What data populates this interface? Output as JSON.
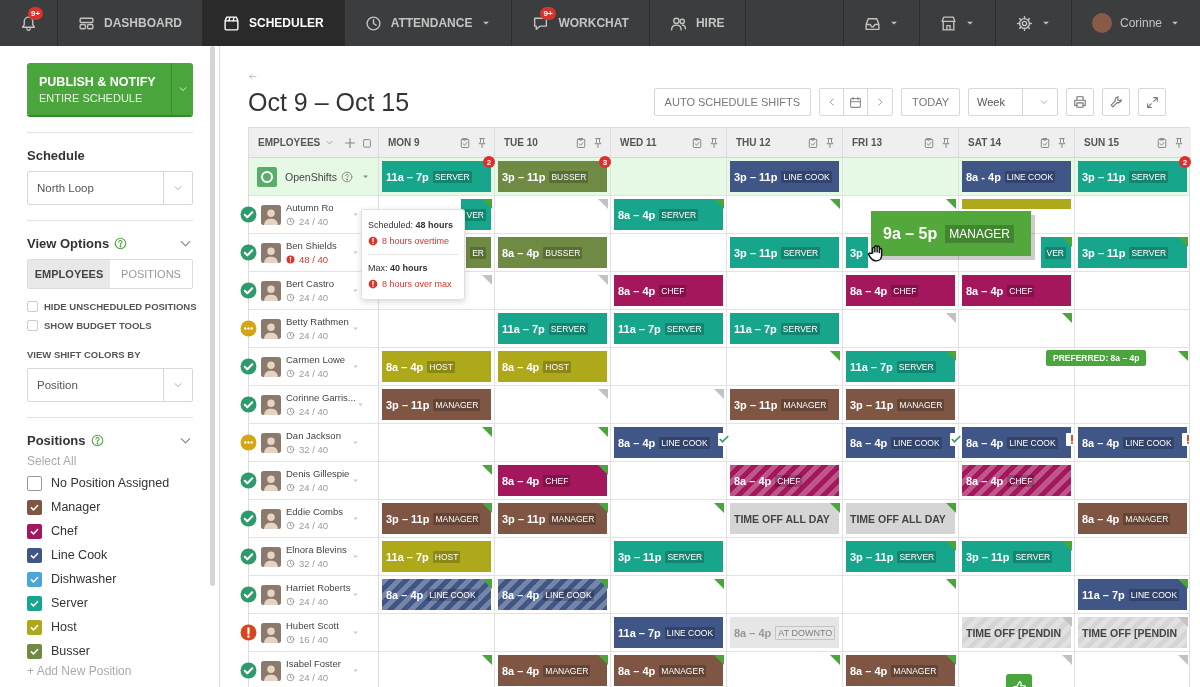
{
  "nav": {
    "items": [
      {
        "badge": "9+",
        "selected": false,
        "dropdown": false
      },
      {
        "label": "DASHBOARD",
        "selected": false,
        "dropdown": false
      },
      {
        "label": "SCHEDULER",
        "selected": true,
        "dropdown": false
      },
      {
        "label": "ATTENDANCE",
        "selected": false,
        "dropdown": true
      },
      {
        "label": "WORKCHAT",
        "badge": "9+",
        "selected": false,
        "dropdown": false
      },
      {
        "label": "HIRE",
        "selected": false,
        "dropdown": false
      }
    ],
    "right": [
      {
        "dropdown": true
      },
      {
        "dropdown": true
      },
      {
        "dropdown": true
      }
    ],
    "user": {
      "name": "Corinne",
      "dropdown": true
    }
  },
  "sidebar": {
    "publish": {
      "title": "PUBLISH & NOTIFY",
      "subtitle": "ENTIRE SCHEDULE"
    },
    "schedule": {
      "label": "Schedule",
      "value": "North Loop"
    },
    "view_options": {
      "title": "View Options",
      "expanded": true,
      "tabs": [
        {
          "label": "EMPLOYEES",
          "selected": true
        },
        {
          "label": "POSITIONS",
          "selected": false
        }
      ],
      "checkboxes": [
        {
          "label": "HIDE UNSCHEDULED POSITIONS",
          "checked": false
        },
        {
          "label": "SHOW BUDGET TOOLS",
          "checked": false
        }
      ],
      "color_by": {
        "label": "VIEW SHIFT COLORS BY",
        "value": "Position"
      }
    },
    "positions": {
      "title": "Positions",
      "expanded": true,
      "select_all": "Select All",
      "items": [
        {
          "label": "No Position Assigned",
          "checked": false
        },
        {
          "label": "Manager",
          "checked": true,
          "color": "#7e5643"
        },
        {
          "label": "Chef",
          "checked": true,
          "color": "#a4175d"
        },
        {
          "label": "Line Cook",
          "checked": true,
          "color": "#3f5687"
        },
        {
          "label": "Dishwasher",
          "checked": true,
          "color": "#4aa6d6"
        },
        {
          "label": "Server",
          "checked": true,
          "color": "#17a58c"
        },
        {
          "label": "Host",
          "checked": true,
          "color": "#aea91a"
        },
        {
          "label": "Busser",
          "checked": true,
          "color": "#6e8a43"
        }
      ],
      "add": "+ Add New Position"
    }
  },
  "header": {
    "title": "Oct 9 – Oct 15",
    "auto_button": "AUTO SCHEDULE SHIFTS",
    "today_button": "TODAY",
    "range": "Week"
  },
  "grid": {
    "employees_label": "EMPLOYEES",
    "days": [
      "MON 9",
      "TUE 10",
      "WED 11",
      "THU 12",
      "FRI 13",
      "SAT 14",
      "SUN 15"
    ],
    "open_shifts": {
      "label": "OpenShifts",
      "cells": [
        {
          "kind": "shift",
          "time": "11a – 7p",
          "role": "SERVER",
          "color": "#17a58c",
          "striped": false,
          "badge": "2"
        },
        {
          "kind": "shift",
          "time": "3p – 11p",
          "role": "BUSSER",
          "color": "#6e8a43",
          "striped": false,
          "badge": "3"
        },
        {
          "kind": "empty"
        },
        {
          "kind": "shift",
          "time": "3p – 11p",
          "role": "LINE COOK",
          "color": "#3f5687",
          "striped": false
        },
        {
          "kind": "empty"
        },
        {
          "kind": "shift",
          "time": "8a - 4p",
          "role": "LINE COOK",
          "color": "#3f5687",
          "striped": false
        },
        {
          "kind": "shift",
          "time": "3p – 11p",
          "role": "SERVER",
          "color": "#17a58c",
          "striped": false,
          "badge": "2"
        }
      ]
    },
    "employees": [
      {
        "name": "Autumn Ro",
        "status_icon": {
          "kind": "ok"
        },
        "hours": "24 / 40",
        "over_hours": false,
        "cells": [
          {
            "kind": "shift",
            "role": "VER",
            "color": "#17a58c",
            "striped": false,
            "flag": {
              "color": "#4aa63c"
            }
          },
          {
            "kind": "empty",
            "flag": {
              "color": "#c2c2c2"
            }
          },
          {
            "kind": "shift",
            "time": "8a – 4p",
            "role": "SERVER",
            "color": "#17a58c",
            "striped": false,
            "flag": {
              "color": "#4aa63c"
            }
          },
          {
            "kind": "empty",
            "flag": {
              "color": "#4aa63c"
            }
          },
          {
            "kind": "empty",
            "flag": {
              "color": "#4aa63c"
            }
          },
          {
            "kind": "shift",
            "color": "#aea91a",
            "striped": false
          },
          {
            "kind": "empty"
          }
        ]
      },
      {
        "name": "Ben Shields",
        "status_icon": {
          "kind": "ok"
        },
        "hours": "48 / 40",
        "over_hours": true,
        "cells": [
          {
            "kind": "shift",
            "role": "ER",
            "color": "#6e8a43",
            "striped": false
          },
          {
            "kind": "shift",
            "time": "8a – 4p",
            "role": "BUSSER",
            "color": "#6e8a43",
            "striped": false
          },
          {
            "kind": "empty"
          },
          {
            "kind": "shift",
            "time": "3p – 11p",
            "role": "SERVER",
            "color": "#17a58c",
            "striped": false
          },
          {
            "kind": "shift",
            "time": "3p",
            "color": "#17a58c",
            "striped": false
          },
          {
            "kind": "shift",
            "role": "VER",
            "color": "#17a58c",
            "striped": false,
            "flag": {
              "color": "#4aa63c"
            }
          },
          {
            "kind": "shift",
            "time": "3p – 11p",
            "role": "SERVER",
            "color": "#17a58c",
            "striped": false,
            "flag": {
              "color": "#4aa63c"
            }
          }
        ]
      },
      {
        "name": "Bert Castro",
        "status_icon": {
          "kind": "ok"
        },
        "hours": "24 / 40",
        "over_hours": false,
        "cells": [
          {
            "kind": "empty",
            "flag": {
              "color": "#c2c2c2"
            }
          },
          {
            "kind": "empty",
            "flag": {
              "color": "#c2c2c2"
            }
          },
          {
            "kind": "shift",
            "time": "8a – 4p",
            "role": "CHEF",
            "color": "#a4175d",
            "striped": false
          },
          {
            "kind": "empty"
          },
          {
            "kind": "shift",
            "time": "8a – 4p",
            "role": "CHEF",
            "color": "#a4175d",
            "striped": false
          },
          {
            "kind": "shift",
            "time": "8a – 4p",
            "role": "CHEF",
            "color": "#a4175d",
            "striped": false
          },
          {
            "kind": "empty"
          }
        ]
      },
      {
        "name": "Betty Rathmen",
        "status_icon": {
          "kind": "pending"
        },
        "hours": "24 / 40",
        "over_hours": false,
        "cells": [
          {
            "kind": "empty"
          },
          {
            "kind": "shift",
            "time": "11a – 7p",
            "role": "SERVER",
            "color": "#17a58c",
            "striped": false
          },
          {
            "kind": "shift",
            "time": "11a – 7p",
            "role": "SERVER",
            "color": "#17a58c",
            "striped": false
          },
          {
            "kind": "shift",
            "time": "11a – 7p",
            "role": "SERVER",
            "color": "#17a58c",
            "striped": false
          },
          {
            "kind": "empty",
            "flag": {
              "color": "#c2c2c2"
            }
          },
          {
            "kind": "empty",
            "flag": {
              "color": "#4aa63c"
            }
          },
          {
            "kind": "empty"
          }
        ]
      },
      {
        "name": "Carmen Lowe",
        "status_icon": {
          "kind": "ok"
        },
        "hours": "24 / 40",
        "over_hours": false,
        "cells": [
          {
            "kind": "shift",
            "time": "8a – 4p",
            "role": "HOST",
            "color": "#aea91a",
            "striped": false
          },
          {
            "kind": "shift",
            "time": "8a – 4p",
            "role": "HOST",
            "color": "#aea91a",
            "striped": false
          },
          {
            "kind": "empty"
          },
          {
            "kind": "empty",
            "flag": {
              "color": "#4aa63c"
            }
          },
          {
            "kind": "shift",
            "time": "11a – 7p",
            "role": "SERVER",
            "color": "#17a58c",
            "striped": false,
            "flag": {
              "color": "#4aa63c"
            }
          },
          {
            "kind": "empty"
          },
          {
            "kind": "empty",
            "flag": {
              "color": "#4aa63c"
            }
          }
        ]
      },
      {
        "name": "Corinne Garris...",
        "status_icon": {
          "kind": "ok"
        },
        "hours": "24 / 40",
        "over_hours": false,
        "cells": [
          {
            "kind": "shift",
            "time": "3p – 11p",
            "role": "MANAGER",
            "color": "#7e5643",
            "striped": false
          },
          {
            "kind": "empty",
            "flag": {
              "color": "#c2c2c2"
            }
          },
          {
            "kind": "empty",
            "flag": {
              "color": "#c2c2c2"
            }
          },
          {
            "kind": "shift",
            "time": "3p – 11p",
            "role": "MANAGER",
            "color": "#7e5643",
            "striped": false
          },
          {
            "kind": "shift",
            "time": "3p – 11p",
            "role": "MANAGER",
            "color": "#7e5643",
            "striped": false
          },
          {
            "kind": "empty"
          },
          {
            "kind": "empty"
          }
        ]
      },
      {
        "name": "Dan Jackson",
        "status_icon": {
          "kind": "pending"
        },
        "hours": "32 / 40",
        "over_hours": false,
        "cells": [
          {
            "kind": "empty",
            "flag": {
              "color": "#4aa63c"
            }
          },
          {
            "kind": "empty",
            "flag": {
              "color": "#4aa63c"
            }
          },
          {
            "kind": "shift",
            "time": "8a – 4p",
            "role": "LINE COOK",
            "color": "#3f5687",
            "striped": false,
            "mark": {
              "kind": "confirmed"
            }
          },
          {
            "kind": "empty"
          },
          {
            "kind": "shift",
            "time": "8a – 4p",
            "role": "LINE COOK",
            "color": "#3f5687",
            "striped": false,
            "mark": {
              "kind": "confirmed"
            }
          },
          {
            "kind": "shift",
            "time": "8a – 4p",
            "role": "LINE COOK",
            "color": "#3f5687",
            "striped": false,
            "mark": {
              "kind": "warning"
            }
          },
          {
            "kind": "shift",
            "time": "8a – 4p",
            "role": "LINE COOK",
            "color": "#3f5687",
            "striped": false,
            "mark": {
              "kind": "warning"
            }
          }
        ]
      },
      {
        "name": "Denis Gillespie",
        "status_icon": {
          "kind": "ok"
        },
        "hours": "24 / 40",
        "over_hours": false,
        "cells": [
          {
            "kind": "empty",
            "flag": {
              "color": "#4aa63c"
            }
          },
          {
            "kind": "shift",
            "time": "8a – 4p",
            "role": "CHEF",
            "color": "#a4175d",
            "striped": false,
            "flag": {
              "color": "#4aa63c"
            }
          },
          {
            "kind": "empty"
          },
          {
            "kind": "shift",
            "time": "8a – 4p",
            "role": "CHEF",
            "color": "#a4175d",
            "striped": true
          },
          {
            "kind": "empty"
          },
          {
            "kind": "shift",
            "time": "8a – 4p",
            "role": "CHEF",
            "color": "#a4175d",
            "striped": true
          },
          {
            "kind": "empty"
          }
        ]
      },
      {
        "name": "Eddie Combs",
        "status_icon": {
          "kind": "ok"
        },
        "hours": "24 / 40",
        "over_hours": false,
        "cells": [
          {
            "kind": "shift",
            "time": "3p – 11p",
            "role": "MANAGER",
            "color": "#7e5643",
            "striped": false,
            "flag": {
              "color": "#4aa63c"
            }
          },
          {
            "kind": "shift",
            "time": "3p – 11p",
            "role": "MANAGER",
            "color": "#7e5643",
            "striped": false,
            "flag": {
              "color": "#4aa63c"
            }
          },
          {
            "kind": "empty",
            "flag": {
              "color": "#4aa63c"
            }
          },
          {
            "kind": "timeoff",
            "label": "TIME OFF ALL DAY",
            "striped": false,
            "flag": {
              "color": "#4aa63c"
            }
          },
          {
            "kind": "timeoff",
            "label": "TIME OFF ALL DAY",
            "striped": false,
            "flag": {
              "color": "#4aa63c"
            }
          },
          {
            "kind": "empty"
          },
          {
            "kind": "shift",
            "time": "8a – 4p",
            "role": "MANAGER",
            "color": "#7e5643",
            "striped": false
          }
        ]
      },
      {
        "name": "Elnora Blevins",
        "status_icon": {
          "kind": "ok"
        },
        "hours": "32 / 40",
        "over_hours": false,
        "cells": [
          {
            "kind": "shift",
            "time": "11a – 7p",
            "role": "HOST",
            "color": "#aea91a",
            "striped": false
          },
          {
            "kind": "empty"
          },
          {
            "kind": "shift",
            "time": "3p – 11p",
            "role": "SERVER",
            "color": "#17a58c",
            "striped": false
          },
          {
            "kind": "empty"
          },
          {
            "kind": "shift",
            "time": "3p – 11p",
            "role": "SERVER",
            "color": "#17a58c",
            "striped": false,
            "flag": {
              "color": "#4aa63c"
            }
          },
          {
            "kind": "shift",
            "time": "3p – 11p",
            "role": "SERVER",
            "color": "#17a58c",
            "striped": false,
            "flag": {
              "color": "#4aa63c"
            }
          },
          {
            "kind": "empty"
          }
        ]
      },
      {
        "name": "Harriet Roberts",
        "status_icon": {
          "kind": "ok"
        },
        "hours": "24 / 40",
        "over_hours": false,
        "cells": [
          {
            "kind": "shift",
            "time": "8a – 4p",
            "role": "LINE COOK",
            "color": "#3f5687",
            "striped": true,
            "flag": {
              "color": "#4aa63c"
            }
          },
          {
            "kind": "shift",
            "time": "8a – 4p",
            "role": "LINE COOK",
            "color": "#3f5687",
            "striped": true,
            "flag": {
              "color": "#4aa63c"
            }
          },
          {
            "kind": "empty",
            "flag": {
              "color": "#4aa63c"
            }
          },
          {
            "kind": "empty"
          },
          {
            "kind": "empty",
            "flag": {
              "color": "#4aa63c"
            }
          },
          {
            "kind": "empty"
          },
          {
            "kind": "shift",
            "time": "11a – 7p",
            "role": "LINE COOK",
            "color": "#3f5687",
            "striped": false,
            "flag": {
              "color": "#4aa63c"
            }
          }
        ]
      },
      {
        "name": "Hubert Scott",
        "status_icon": {
          "kind": "alert"
        },
        "hours": "16 / 40",
        "over_hours": false,
        "cells": [
          {
            "kind": "empty"
          },
          {
            "kind": "empty"
          },
          {
            "kind": "shift",
            "time": "11a – 7p",
            "role": "LINE COOK",
            "color": "#3f5687",
            "striped": false
          },
          {
            "kind": "elsewhere",
            "time": "8a – 4p",
            "role": "AT DOWNTO"
          },
          {
            "kind": "empty"
          },
          {
            "kind": "timeoff",
            "label": "TIME OFF [PENDIN",
            "striped": true,
            "flag": {
              "color": "#c2c2c2"
            }
          },
          {
            "kind": "timeoff",
            "label": "TIME OFF [PENDIN",
            "striped": true,
            "flag": {
              "color": "#c2c2c2"
            }
          }
        ]
      },
      {
        "name": "Isabel Foster",
        "status_icon": {
          "kind": "ok"
        },
        "hours": "24 / 40",
        "over_hours": false,
        "cells": [
          {
            "kind": "empty",
            "flag": {
              "color": "#4aa63c"
            }
          },
          {
            "kind": "shift",
            "time": "8a – 4p",
            "role": "MANAGER",
            "color": "#7e5643",
            "striped": false,
            "flag": {
              "color": "#4aa63c"
            }
          },
          {
            "kind": "shift",
            "time": "8a – 4p",
            "role": "MANAGER",
            "color": "#7e5643",
            "striped": false,
            "flag": {
              "color": "#4aa63c"
            }
          },
          {
            "kind": "empty",
            "flag": {
              "color": "#4aa63c"
            }
          },
          {
            "kind": "shift",
            "time": "8a – 4p",
            "role": "MANAGER",
            "color": "#7e5643",
            "striped": false,
            "flag": {
              "color": "#4aa63c"
            }
          },
          {
            "kind": "empty",
            "flag": {
              "color": "#c2c2c2"
            }
          },
          {
            "kind": "empty",
            "flag": {
              "color": "#c2c2c2"
            }
          }
        ]
      }
    ],
    "tooltip": {
      "sections": [
        {
          "heading": "Scheduled: **48 hours**",
          "warning": "8 hours overtime"
        },
        {
          "heading": "Max: **40 hours**",
          "warning": "8 hours over max"
        }
      ]
    },
    "drag_shift": {
      "time": "9a – 5p",
      "role": "MANAGER"
    },
    "preferred": "PREFERRED: 8a – 4p"
  }
}
